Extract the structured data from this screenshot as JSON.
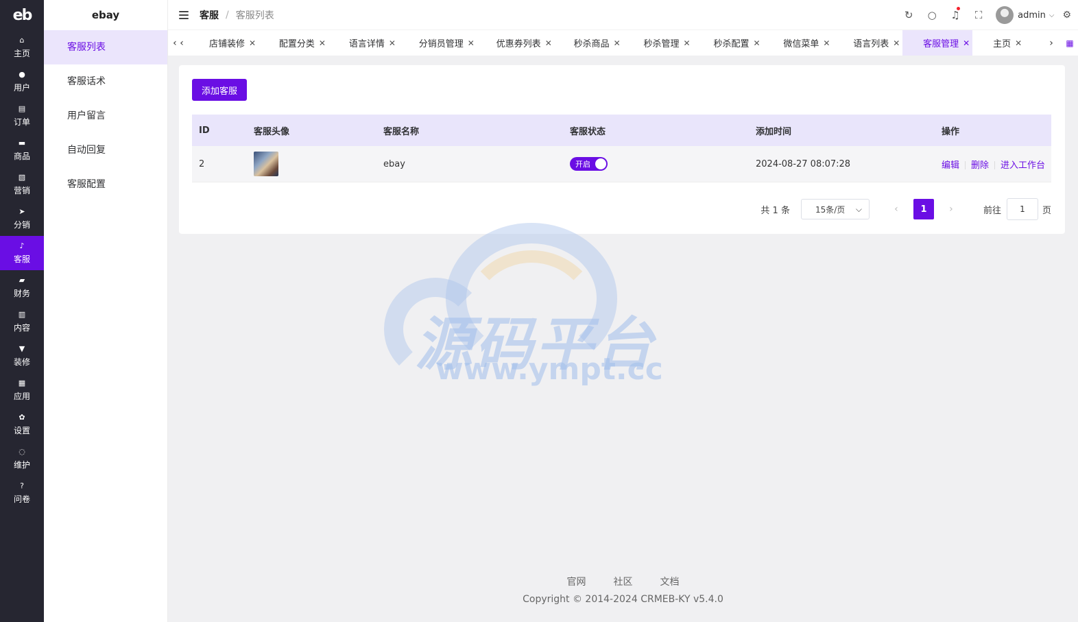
{
  "rail": {
    "logo": "eb",
    "items": [
      {
        "label": "主页",
        "icon": "home-icon",
        "glyph": "⌂"
      },
      {
        "label": "用户",
        "icon": "user-icon",
        "glyph": "●"
      },
      {
        "label": "订单",
        "icon": "order-icon",
        "glyph": "▤"
      },
      {
        "label": "商品",
        "icon": "product-icon",
        "glyph": "▬"
      },
      {
        "label": "营销",
        "icon": "marketing-icon",
        "glyph": "▧"
      },
      {
        "label": "分销",
        "icon": "distribution-icon",
        "glyph": "➤"
      },
      {
        "label": "客服",
        "icon": "bell-icon",
        "glyph": "♪"
      },
      {
        "label": "财务",
        "icon": "finance-icon",
        "glyph": "▰"
      },
      {
        "label": "内容",
        "icon": "content-icon",
        "glyph": "▥"
      },
      {
        "label": "装修",
        "icon": "decorate-icon",
        "glyph": "▼"
      },
      {
        "label": "应用",
        "icon": "apps-icon",
        "glyph": "▦"
      },
      {
        "label": "设置",
        "icon": "settings-icon",
        "glyph": "✿"
      },
      {
        "label": "维护",
        "icon": "maintenance-icon",
        "glyph": "◌"
      },
      {
        "label": "问卷",
        "icon": "question-icon",
        "glyph": "?"
      }
    ],
    "active_index": 6
  },
  "sidebar": {
    "brand": "ebay",
    "items": [
      {
        "label": "客服列表"
      },
      {
        "label": "客服话术"
      },
      {
        "label": "用户留言"
      },
      {
        "label": "自动回复"
      },
      {
        "label": "客服配置"
      }
    ],
    "active_index": 0
  },
  "header": {
    "crumb_parent": "客服",
    "crumb_sep": "/",
    "crumb_current": "客服列表",
    "username": "admin"
  },
  "tabs": {
    "items": [
      {
        "label": "店铺装修"
      },
      {
        "label": "配置分类"
      },
      {
        "label": "语言详情"
      },
      {
        "label": "分销员管理"
      },
      {
        "label": "优惠券列表"
      },
      {
        "label": "秒杀商品"
      },
      {
        "label": "秒杀管理"
      },
      {
        "label": "秒杀配置"
      },
      {
        "label": "微信菜单"
      },
      {
        "label": "语言列表"
      },
      {
        "label": "客服管理"
      },
      {
        "label": "主页"
      }
    ],
    "active_index": 10
  },
  "main": {
    "add_button": "添加客服",
    "table": {
      "headers": [
        "ID",
        "客服头像",
        "客服名称",
        "客服状态",
        "添加时间",
        "操作"
      ],
      "rows": [
        {
          "id": "2",
          "name": "ebay",
          "status": "开启",
          "time": "2024-08-27 08:07:28"
        }
      ],
      "actions": [
        "编辑",
        "删除",
        "进入工作台"
      ]
    },
    "pagination": {
      "total": "共 1 条",
      "page_size": "15条/页",
      "current_page": "1",
      "goto_label": "前往",
      "goto_value": "1",
      "goto_unit": "页"
    }
  },
  "watermark": {
    "title": "源码平台",
    "url": "www.ympt.cc"
  },
  "footer": {
    "links": [
      "官网",
      "社区",
      "文档"
    ],
    "copyright": "Copyright © 2014-2024 CRMEB-KY v5.4.0"
  },
  "colors": {
    "accent": "#6a0ee4",
    "rail_bg": "#262631",
    "active_bg": "#ebe5fc"
  }
}
